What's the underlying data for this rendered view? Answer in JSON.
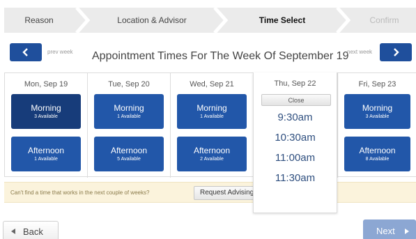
{
  "steps": [
    {
      "label": "Reason",
      "state": "done"
    },
    {
      "label": "Location & Advisor",
      "state": "done"
    },
    {
      "label": "Time Select",
      "state": "active"
    },
    {
      "label": "Confirm",
      "state": "disabled"
    }
  ],
  "week_nav": {
    "prev_label": "prev week",
    "next_label": "next week",
    "title": "Appointment Times For The Week Of September 19"
  },
  "days": [
    {
      "label": "Mon, Sep 19",
      "morning": {
        "label": "Morning",
        "sub": "3 Available"
      },
      "afternoon": {
        "label": "Afternoon",
        "sub": "1 Available"
      }
    },
    {
      "label": "Tue, Sep 20",
      "morning": {
        "label": "Morning",
        "sub": "1 Available"
      },
      "afternoon": {
        "label": "Afternoon",
        "sub": "5 Available"
      }
    },
    {
      "label": "Wed, Sep 21",
      "morning": {
        "label": "Morning",
        "sub": "1 Available"
      },
      "afternoon": {
        "label": "Afternoon",
        "sub": "2 Available"
      }
    },
    {
      "label": "Thu, Sep 22"
    },
    {
      "label": "Fri, Sep 23",
      "morning": {
        "label": "Morning",
        "sub": "3 Available"
      },
      "afternoon": {
        "label": "Afternoon",
        "sub": "8 Available"
      }
    }
  ],
  "expanded_day": {
    "label": "Thu, Sep 22",
    "close_label": "Close",
    "times": [
      "9:30am",
      "10:30am",
      "11:00am",
      "11:30am"
    ]
  },
  "help": {
    "text": "Can't find a time that works in the next couple of weeks?",
    "button_label": "Request Advising"
  },
  "footer": {
    "back_label": "Back",
    "next_label": "Next"
  },
  "colors": {
    "slot": "#2257a9",
    "slot_selected": "#173c7a",
    "next_disabled": "#8ca7d3",
    "help_bg": "#fbf3dc"
  }
}
